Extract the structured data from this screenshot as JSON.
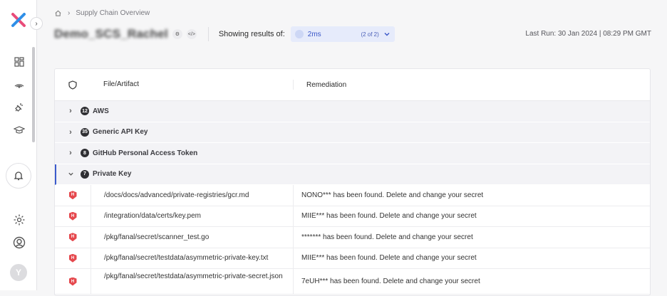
{
  "sidebar": {
    "logo_icon": "harness-x-logo",
    "expand_icon": "chevron-right-icon",
    "nav": [
      "dashboard-icon",
      "signal-icon",
      "plug-icon",
      "graduation-cap-icon"
    ],
    "bell_icon": "bell-icon",
    "settings_icon": "gear-icon",
    "account_icon": "user-circle-icon",
    "avatar_initial": "Y"
  },
  "breadcrumb": {
    "home_icon": "home-icon",
    "separator": "›",
    "current": "Supply Chain Overview"
  },
  "header": {
    "pipeline_name": "Demo_SCS_Rachel",
    "showing_label": "Showing results of:",
    "selected_result": "2ms",
    "result_count": "(2 of 2)",
    "last_run": "Last Run: 30 Jan 2024 | 08:29 PM GMT"
  },
  "table": {
    "columns": {
      "file": "File/Artifact",
      "remediation": "Remediation"
    },
    "groups": [
      {
        "count": "12",
        "label": "AWS",
        "expanded": false
      },
      {
        "count": "35",
        "label": "Generic API Key",
        "expanded": false
      },
      {
        "count": "8",
        "label": "GitHub Personal Access Token",
        "expanded": false
      },
      {
        "count": "7",
        "label": "Private Key",
        "expanded": true
      }
    ],
    "rows": [
      {
        "severity": "H",
        "file": "/docs/docs/advanced/private-registries/gcr.md",
        "remediation": "NONO*** has been found. Delete and change your secret"
      },
      {
        "severity": "H",
        "file": "/integration/data/certs/key.pem",
        "remediation": "MIIE*** has been found. Delete and change your secret"
      },
      {
        "severity": "H",
        "file": "/pkg/fanal/secret/scanner_test.go",
        "remediation": "******* has been found. Delete and change your secret"
      },
      {
        "severity": "H",
        "file": "/pkg/fanal/secret/testdata/asymmetric-private-key.txt",
        "remediation": "MIIE*** has been found. Delete and change your secret"
      },
      {
        "severity": "H",
        "file": "/pkg/fanal/secret/testdata/asymmetric-private-secret.json",
        "remediation": "7eUH*** has been found. Delete and change your secret"
      }
    ]
  },
  "colors": {
    "accent": "#3b5bcc",
    "severity_high": "#e5484d",
    "select_bg": "#e6ebfb"
  }
}
